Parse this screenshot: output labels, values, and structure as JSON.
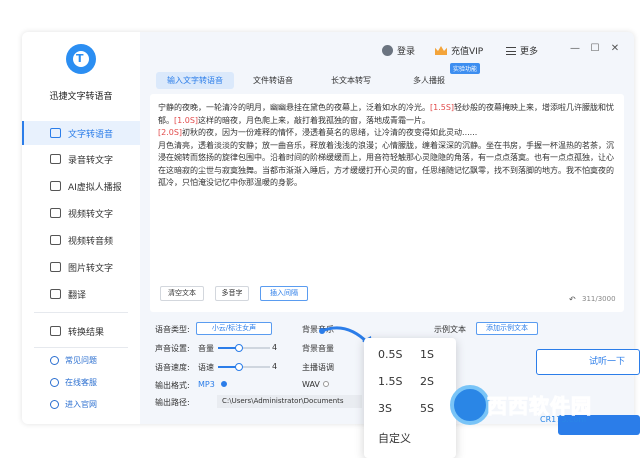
{
  "sidebar": {
    "app_title": "迅捷文字转语音",
    "items": [
      {
        "label": "文字转语音"
      },
      {
        "label": "录音转文字"
      },
      {
        "label": "AI虚拟人播报"
      },
      {
        "label": "视频转文字"
      },
      {
        "label": "视频转音频"
      },
      {
        "label": "图片转文字"
      },
      {
        "label": "翻译"
      }
    ],
    "results": "转换结果",
    "links": [
      {
        "label": "常见问题"
      },
      {
        "label": "在线客服"
      },
      {
        "label": "进入官网"
      }
    ]
  },
  "header": {
    "login": "登录",
    "vip": "充值VIP",
    "more": "更多"
  },
  "tabs": [
    {
      "label": "输入文字转语音"
    },
    {
      "label": "文件转语音"
    },
    {
      "label": "长文本转写"
    },
    {
      "label": "多人播报"
    }
  ],
  "lab_badge": "实验功能",
  "editor": {
    "paragraphs": [
      {
        "segments": [
          {
            "t": "宁静的夜晚，一轮清冷的明月，幽幽悬挂在黛色的夜幕上，泛着如水的冷光。"
          },
          {
            "t": "[1.5S]",
            "pause": true
          },
          {
            "t": "轻纱般的夜幕掩映上来，增添啦几许朦胧和忧郁。"
          },
          {
            "t": "[1.0S]",
            "pause": true
          },
          {
            "t": "这样的暗夜，月色爬上来，敲打着我孤独的窗，落地成青霜一片。"
          }
        ]
      },
      {
        "segments": [
          {
            "t": "[2.0S]",
            "pause": true
          },
          {
            "t": "初秋的夜，因为一份难释的情怀，浸透着莫名的思绪，让冷清的夜变得如此灵动......"
          }
        ]
      },
      {
        "segments": [
          {
            "t": "月色清亮，透着淡淡的安静；放一曲音乐，释放着浅浅的浪漫；心情朦胧，缠着深深的沉静。坐在书房，手握一杯温热的茗茶，沉浸在婉转而悠扬的旋律包围中。沿着时间的阶梯缓缓而上，用音符轻触那心灵隐隐的角落，有一点点落寞。也有一点点孤独，让心在这暗寂的尘世与寂寞独舞。当都市渐渐入睡后，方才缓缓打开心灵的窗，任思绪随记忆飘零，找不到落脚的地方。我不怕寞夜的孤冷，只怕淹没记忆中你那温暖的身影。"
          }
        ]
      }
    ],
    "clear_btn": "清空文本",
    "polyphone_btn": "多音字",
    "insert_pause_btn": "插入间隔",
    "counter": "311/3000"
  },
  "settings": {
    "voice_type_label": "语音类型:",
    "voice_type_value": "小云/标注女声",
    "bg_music_label": "背景音乐",
    "example_label": "示例文本",
    "add_example": "添加示例文本",
    "volume_set_label": "声音设置:",
    "volume_label": "音量",
    "volume_value": "4",
    "volume_level": 0.4,
    "bg_volume_label": "背景音量",
    "speed_set_label": "语音速度:",
    "speed_label": "语速",
    "speed_value": "4",
    "speed_level": 0.4,
    "anchor_label": "主播语调",
    "format_label": "输出格式:",
    "format_mp3": "MP3",
    "format_wav": "WAV",
    "path_label": "输出路径:",
    "path_value": "C:\\Users\\Administrator\\Documents",
    "listen_btn": "试听一下"
  },
  "pause_popup": {
    "options": [
      "0.5S",
      "1S",
      "1.5S",
      "2S",
      "3S",
      "5S",
      "自定义"
    ]
  },
  "watermark": {
    "text": "西西软件园",
    "sub": "CR173.com"
  }
}
